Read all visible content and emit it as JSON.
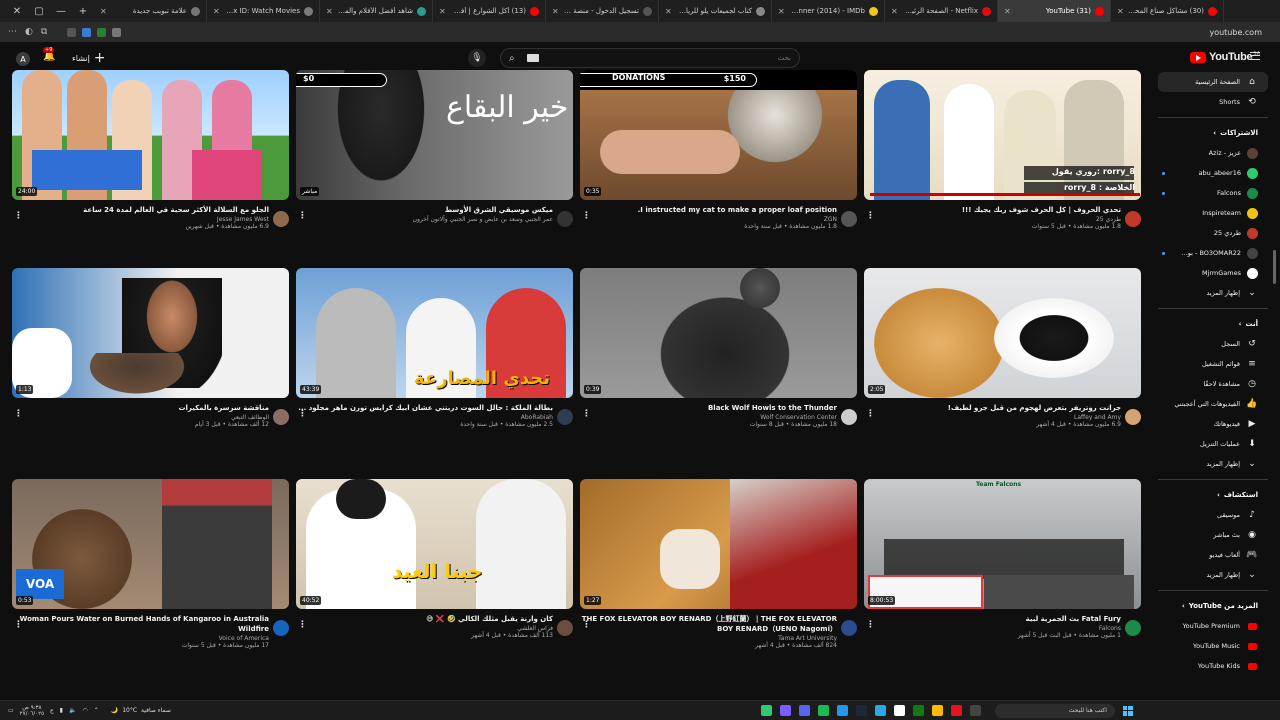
{
  "browser": {
    "tabs": [
      {
        "title": "(30) مشاكل صناع المحتوى (الت...",
        "color": "#ff0000"
      },
      {
        "title": "(31) YouTube",
        "color": "#ff0000",
        "active": true
      },
      {
        "title": "Netflix - الصفحة الرئيسية",
        "color": "#e50914"
      },
      {
        "title": "The Maze Runner (2014) - IMDb",
        "color": "#f5c518"
      },
      {
        "title": "كتاب لجميعات يلو للرياضيات 5...",
        "color": "#888888"
      },
      {
        "title": "تسجيل الدخول - منصة إثرو التعل...",
        "color": "#555555"
      },
      {
        "title": "(13) أكل الشوارع | أفضل شاور...",
        "color": "#ff0000"
      },
      {
        "title": "شاهد أفضل الأفلام والمسلسلا...",
        "color": "#2a9d8f"
      },
      {
        "title": "MovieBox ID: Watch Movies...",
        "color": "#7b7b7b"
      },
      {
        "title": "علامة تبويب جديدة",
        "color": "#777777"
      }
    ],
    "url": "youtube.com"
  },
  "header": {
    "avatar_letter": "A",
    "notif_badge": "+9",
    "create_label": "إنشاء",
    "search_placeholder": "بحث",
    "logo_text": "YouTube",
    "country": "SA"
  },
  "videos": [
    {
      "title": "تحدي الحروف | كل الحرف شوف ربك يجيك !!!",
      "channel": "طردي 25",
      "stats": "1.8 مليون مشاهدة • قبل 5 سنوات",
      "duration": "",
      "avatar": "#c0392b"
    },
    {
      "title": "I instructed my cat to make a proper loaf position.",
      "channel": "ZGN",
      "stats": "1.8 مليون مشاهدة • قبل سنة واحدة",
      "duration": "0:35",
      "avatar": "#555555"
    },
    {
      "title": "ميكس موسيقي الشرق الأوسط",
      "channel": "عمر الجنبي وسعد بن عايض و نصر الجنبي وآلاتون أخرون",
      "stats": "",
      "duration": "مباشر",
      "avatar": "#333333"
    },
    {
      "title": "الجلو مع السلالة الأكثر سحبة في العالم لمدة 24 ساعة",
      "channel": "Jesse James West",
      "stats": "6.9 مليون مشاهدة • قبل شهرين",
      "duration": "24:00",
      "avatar": "#8e6b4a"
    },
    {
      "title": "جرانت روتريفر بتعرض لهجوم من قبل جرو لطيف!",
      "channel": "Laffey and Amy",
      "stats": "6.9 مليون مشاهدة • قبل 4 أشهر",
      "duration": "2:05",
      "avatar": "#d4a373"
    },
    {
      "title": "Black Wolf Howls to the Thunder",
      "channel": "Wolf Conservation Center",
      "stats": "18 مليون مشاهدة • قبل 8 سنوات",
      "duration": "0:39",
      "avatar": "#cccccc"
    },
    {
      "title": "بطالة الملكة : حالل السوت دربتني عشان ابيك كرايس تورن ماهر مجلود ...",
      "channel": "AboRabiah",
      "stats": "2.5 مليون مشاهدة • قبل سنة واحدة",
      "duration": "43:39",
      "avatar": "#2c3e50"
    },
    {
      "title": "مناقشة سرسرة بالمكيرات",
      "channel": "الوظائف التبعي",
      "stats": "12 ألف مشاهدة • قبل 3 أيام",
      "duration": "1:13",
      "avatar": "#8d6e63"
    },
    {
      "title": "Fatal Fury بث الجمرية لبية",
      "channel": "Falcons",
      "stats": "1 مليون مشاهدة • قبل البث قبل 5 أشهر",
      "duration": "8:00:53",
      "avatar": "#1b8a4a"
    },
    {
      "title": "THE FOX ELEVATOR BOY RENARD（上野紅蘭） | THE FOX ELEVATOR BOY RENARD（UENO Nagomi）",
      "channel": "Tama Art University",
      "stats": "824 ألف مشاهدة • قبل 4 أشهر",
      "duration": "1:27",
      "avatar": "#2d4b8f"
    },
    {
      "title": "كان وارنة يقبل مثلك الكالي 🤣 ❌ 😅",
      "channel": "فراس العلشي",
      "stats": "113 ألف مشاهدة • قبل 4 أشهر",
      "duration": "40:52",
      "avatar": "#6d4c41"
    },
    {
      "title": "Woman Pours Water on Burned Hands of Kangaroo in Australia Wildfire",
      "channel": "Voice of America",
      "stats": "17 مليون مشاهدة • قبل 5 سنوات",
      "duration": "0:53",
      "avatar": "#1565c0"
    }
  ],
  "thumb_text": {
    "donations": "DONATIONS",
    "don_left": "$0",
    "don_right": "$150",
    "arabic_calligraphy": "خير البقاع",
    "overlay1": "روري يقول: rorry_8",
    "overlay2": "rorry_8 : الخلاصة",
    "challenge": "تحدي المصارعة",
    "eid": "جبنا العيد",
    "voa": "VOA",
    "team": "Team Falcons"
  },
  "sidebar": {
    "main": [
      {
        "label": "الصفحة الرئيسية",
        "icon": "home-icon",
        "glyph": "⌂",
        "active": true
      },
      {
        "label": "Shorts",
        "icon": "shorts-icon",
        "glyph": "⟲"
      }
    ],
    "subs_header": "الاشتراكات",
    "subs": [
      {
        "label": "عزيز - Aziz",
        "color": "#5d4037",
        "dot": false
      },
      {
        "label": "abu_abeer16",
        "color": "#2ecc71",
        "dot": true
      },
      {
        "label": "Falcons",
        "color": "#1b8a4a",
        "dot": true
      },
      {
        "label": "Inspireteam",
        "color": "#f1c40f",
        "dot": false
      },
      {
        "label": "طردي 25",
        "color": "#c0392b",
        "dot": false
      },
      {
        "label": "BO3OMAR22 - بو...",
        "color": "#444444",
        "dot": true
      },
      {
        "label": "MjrmGames",
        "color": "#ffffff",
        "dot": false
      },
      {
        "label": "إظهار المزيد",
        "color": "",
        "dot": false
      }
    ],
    "you_header": "أنت",
    "you": [
      {
        "label": "السجل",
        "glyph": "↺"
      },
      {
        "label": "قوائم التشغيل",
        "glyph": "≡"
      },
      {
        "label": "مشاهدة لاحقًا",
        "glyph": "◷"
      },
      {
        "label": "الفيديوهات التي أعجبتني",
        "glyph": "👍"
      },
      {
        "label": "فيديوهاتك",
        "glyph": "▶"
      },
      {
        "label": "عمليات التنزيل",
        "glyph": "⬇"
      },
      {
        "label": "إظهار المزيد",
        "glyph": "⌄"
      }
    ],
    "explore_header": "استكشاف",
    "explore": [
      {
        "label": "موسيقى",
        "glyph": "♪"
      },
      {
        "label": "بث مباشر",
        "glyph": "◉"
      },
      {
        "label": "ألعاب فيديو",
        "glyph": "🎮"
      },
      {
        "label": "إظهار المزيد",
        "glyph": "⌄"
      }
    ],
    "more_header": "المزيد من YouTube",
    "more": [
      {
        "label": "YouTube Premium"
      },
      {
        "label": "YouTube Music"
      },
      {
        "label": "YouTube Kids"
      }
    ]
  },
  "taskbar": {
    "time": "٩:٣٨ ص",
    "date": "٢٧/٠٦/٠٢٥",
    "weather": "سماء صافية",
    "temp": "10°C",
    "search": "اكتب هنا للبحث"
  }
}
